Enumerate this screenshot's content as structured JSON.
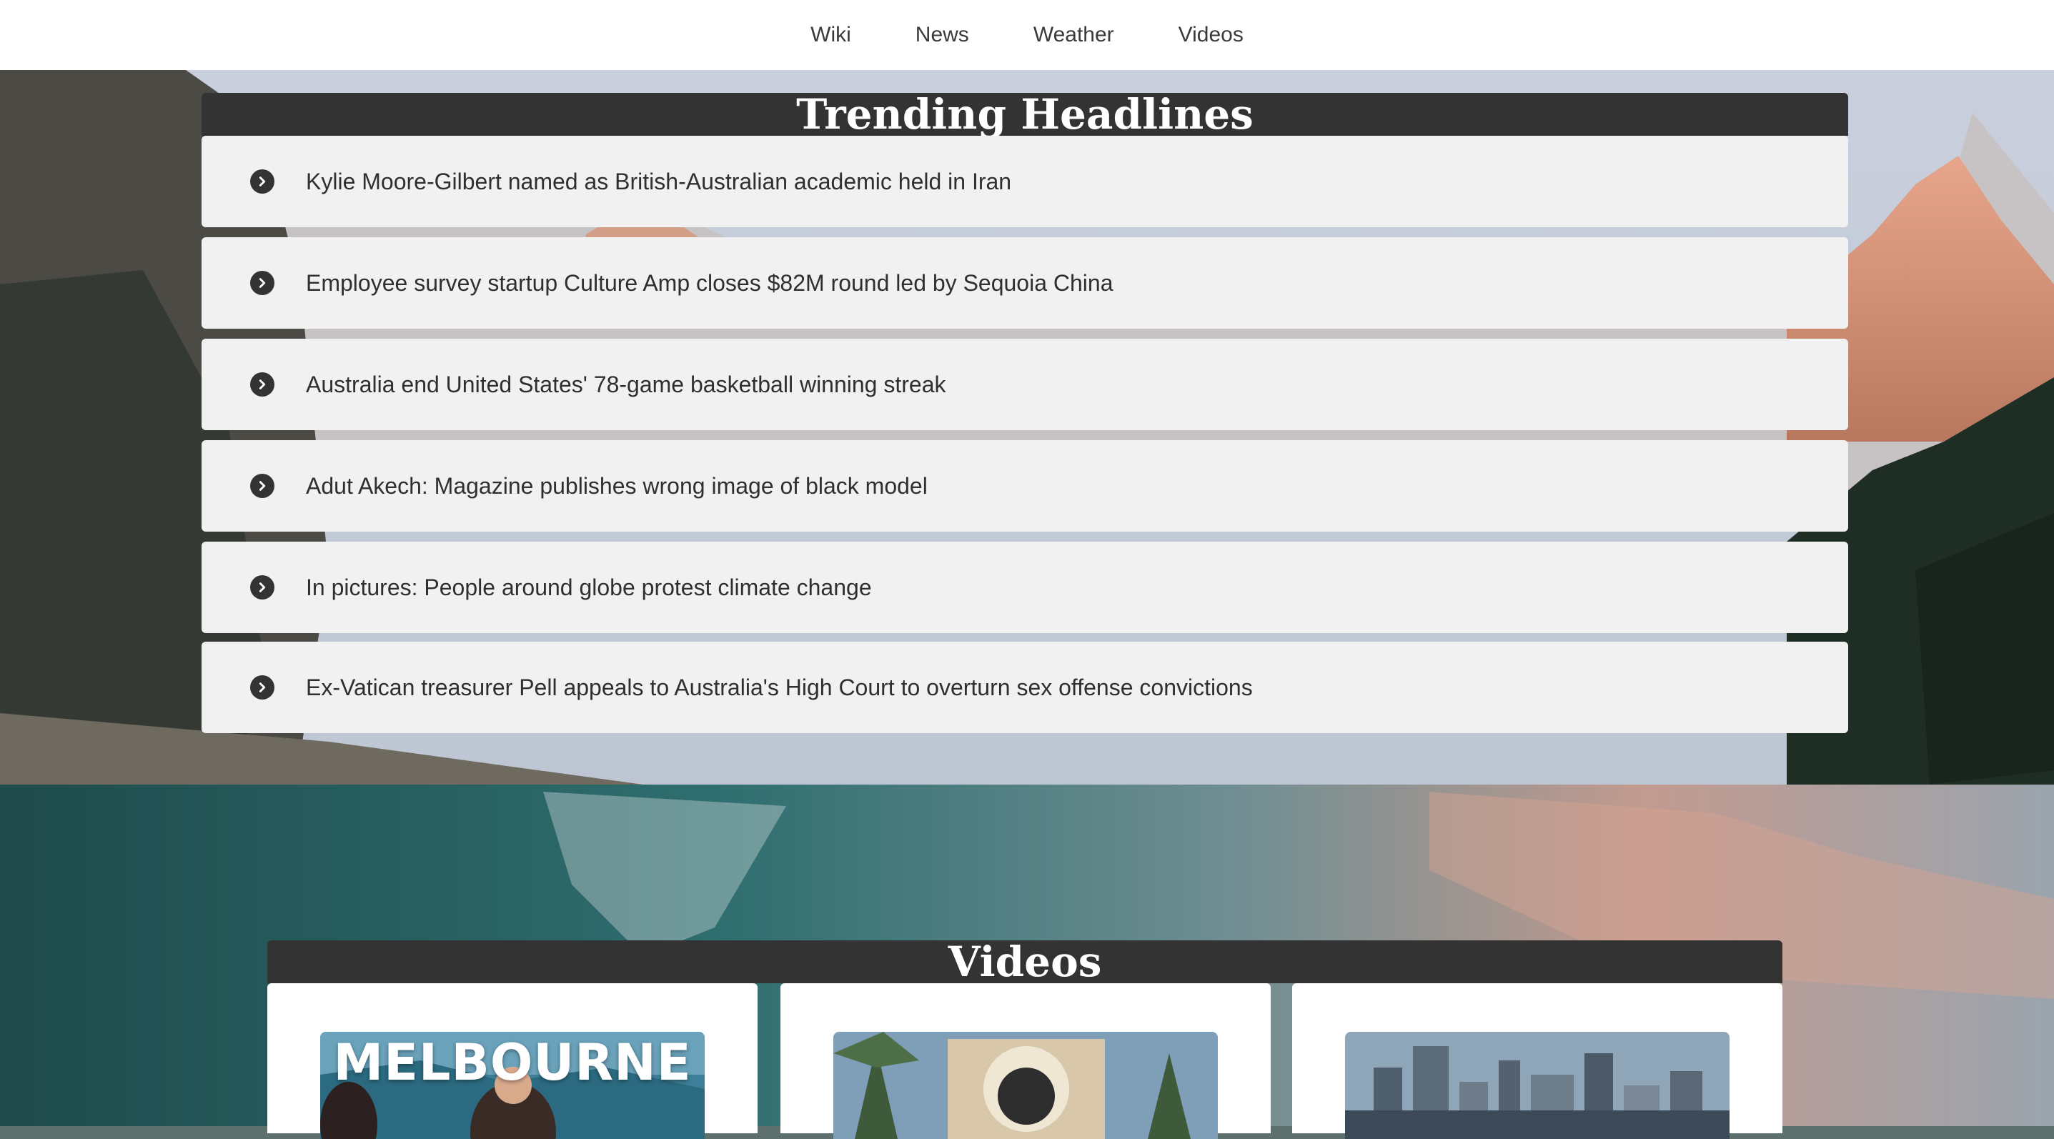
{
  "nav": {
    "items": [
      {
        "label": "Wiki"
      },
      {
        "label": "News"
      },
      {
        "label": "Weather"
      },
      {
        "label": "Videos"
      }
    ]
  },
  "trending": {
    "title": "Trending Headlines",
    "icon": "chevron-right-circle-icon",
    "headlines": [
      {
        "text": "Kylie Moore-Gilbert named as British-Australian academic held in Iran"
      },
      {
        "text": "Employee survey startup Culture Amp closes $82M round led by Sequoia China"
      },
      {
        "text": "Australia end United States' 78-game basketball winning streak"
      },
      {
        "text": "Adut Akech: Magazine publishes wrong image of black model"
      },
      {
        "text": "In pictures: People around globe protest climate change"
      },
      {
        "text": "Ex-Vatican treasurer Pell appeals to Australia's High Court to overturn sex offense convictions"
      }
    ]
  },
  "videos": {
    "title": "Videos",
    "cards": [
      {
        "thumb_text": "MELBOURNE"
      },
      {
        "thumb_text": ""
      },
      {
        "thumb_text": ""
      }
    ]
  },
  "colors": {
    "nav_bg": "#ffffff",
    "header_bg": "#333333",
    "card_bg": "#f1f1f1"
  }
}
